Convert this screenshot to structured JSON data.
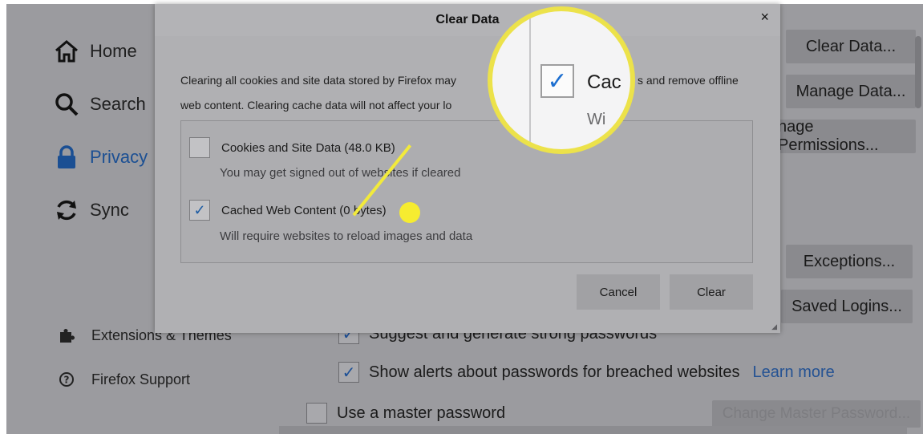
{
  "sidebar": {
    "items": [
      {
        "label": "Home",
        "icon": "home-icon"
      },
      {
        "label": "Search",
        "icon": "search-icon"
      },
      {
        "label": "Privacy",
        "icon": "lock-icon"
      },
      {
        "label": "Sync",
        "icon": "sync-icon"
      }
    ],
    "bottom_items": [
      {
        "label": "Extensions & Themes",
        "icon": "puzzle-icon"
      },
      {
        "label": "Firefox Support",
        "icon": "help-icon"
      }
    ]
  },
  "background": {
    "buttons": {
      "clear_data": "Clear Data...",
      "manage_data": "Manage Data...",
      "manage_permissions": "nage Permissions...",
      "exceptions": "Exceptions...",
      "saved_logins": "Saved Logins..."
    },
    "passwords": {
      "suggest": "Suggest and generate strong passwords",
      "alerts": "Show alerts about passwords for breached websites",
      "learn_more": "Learn more",
      "master": "Use a master password",
      "change_master": "Change Master Password..."
    }
  },
  "dialog": {
    "title": "Clear Data",
    "close": "×",
    "description_line1": "Clearing all cookies and site data stored by Firefox may",
    "description_line1_end": "s and remove offline",
    "description_line2": "web content. Clearing cache data will not affect your lo",
    "options": [
      {
        "label": "Cookies and Site Data (48.0 KB)",
        "sub": "You may get signed out of websites if cleared",
        "checked": false
      },
      {
        "label": "Cached Web Content (0 bytes)",
        "sub": "Will require websites to reload images and data",
        "checked": true
      }
    ],
    "cancel": "Cancel",
    "clear": "Clear"
  },
  "magnifier": {
    "text": "Cac",
    "sub": "Wi",
    "check": "✓"
  },
  "colors": {
    "highlight": "#f2ea3b",
    "checkmark": "#1d6fd0"
  }
}
